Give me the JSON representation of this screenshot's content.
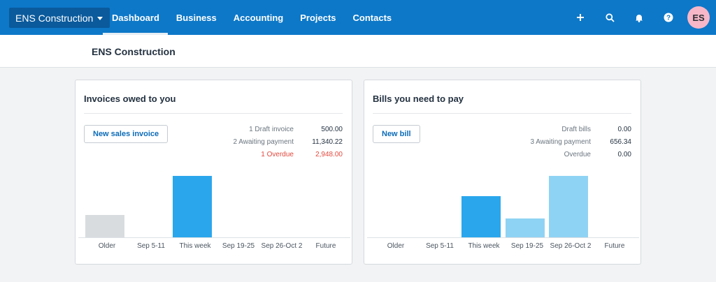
{
  "topbar": {
    "org_name": "ENS Construction",
    "nav": [
      "Dashboard",
      "Business",
      "Accounting",
      "Projects",
      "Contacts"
    ],
    "icons": [
      "plus-icon",
      "search-icon",
      "bell-icon",
      "help-icon"
    ],
    "avatar_initials": "ES",
    "colors": {
      "bar": "#0d78c8",
      "org_switch": "#0a5a9c",
      "avatar": "#f7b7c8"
    }
  },
  "page": {
    "title": "ENS Construction"
  },
  "invoices": {
    "title": "Invoices owed to you",
    "button": "New sales invoice",
    "summary": [
      {
        "label": "1 Draft invoice",
        "value": "500.00"
      },
      {
        "label": "2 Awaiting payment",
        "value": "11,340.22"
      },
      {
        "label": "1 Overdue",
        "value": "2,948.00"
      }
    ],
    "categories": [
      "Older",
      "Sep 5-11",
      "This week",
      "Sep 19-25",
      "Sep 26-Oct 2",
      "Future"
    ]
  },
  "bills": {
    "title": "Bills you need to pay",
    "button": "New bill",
    "summary": [
      {
        "label": "Draft bills",
        "value": "0.00"
      },
      {
        "label": "3 Awaiting payment",
        "value": "656.34"
      },
      {
        "label": "Overdue",
        "value": "0.00"
      }
    ],
    "categories": [
      "Older",
      "Sep 5-11",
      "This week",
      "Sep 19-25",
      "Sep 26-Oct 2",
      "Future"
    ]
  },
  "chart_data": [
    {
      "type": "bar",
      "categories": [
        "Older",
        "Sep 5-11",
        "This week",
        "Sep 19-25",
        "Sep 26-Oct 2",
        "Future"
      ],
      "values": [
        0.36,
        0,
        1,
        0,
        0,
        0
      ],
      "colors": [
        "#d9dcdf",
        "#2aa7ec",
        "#2aa7ec",
        "#2aa7ec",
        "#2aa7ec",
        "#2aa7ec"
      ]
    },
    {
      "type": "bar",
      "categories": [
        "Older",
        "Sep 5-11",
        "This week",
        "Sep 19-25",
        "Sep 26-Oct 2",
        "Future"
      ],
      "values": [
        0,
        0,
        0.67,
        0.31,
        1,
        0
      ],
      "colors": [
        "#2aa7ec",
        "#2aa7ec",
        "#2aa7ec",
        "#8fd3f4",
        "#8fd3f4",
        "#8fd3f4"
      ]
    }
  ]
}
